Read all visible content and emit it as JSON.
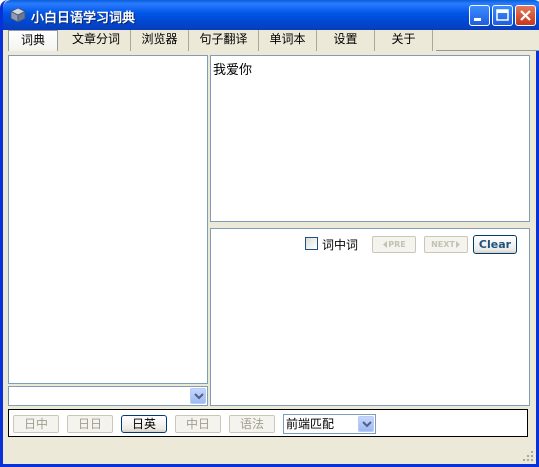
{
  "window": {
    "title": "小白日语学习词典",
    "controls": [
      "minimize",
      "maximize",
      "close"
    ]
  },
  "tabs": [
    {
      "label": "词典",
      "active": true
    },
    {
      "label": "文章分词",
      "active": false
    },
    {
      "label": "浏览器",
      "active": false
    },
    {
      "label": "句子翻译",
      "active": false
    },
    {
      "label": "单词本",
      "active": false
    },
    {
      "label": "设置",
      "active": false
    },
    {
      "label": "关于",
      "active": false
    }
  ],
  "search": {
    "input_text": "我爱你",
    "combo_value": ""
  },
  "results": {
    "in_word_label": "词中词",
    "in_word_checked": false,
    "pre_label": "PRE",
    "next_label": "NEXT",
    "clear_label": "Clear"
  },
  "modes": {
    "buttons": [
      {
        "label": "日中",
        "selected": false
      },
      {
        "label": "日日",
        "selected": false
      },
      {
        "label": "日英",
        "selected": true
      },
      {
        "label": "中日",
        "selected": false
      },
      {
        "label": "语法",
        "selected": false
      }
    ],
    "match_value": "前端匹配"
  },
  "colors": {
    "titlebar": "#0055e5",
    "frame": "#0831d9",
    "clear_text": "#1c5180"
  }
}
